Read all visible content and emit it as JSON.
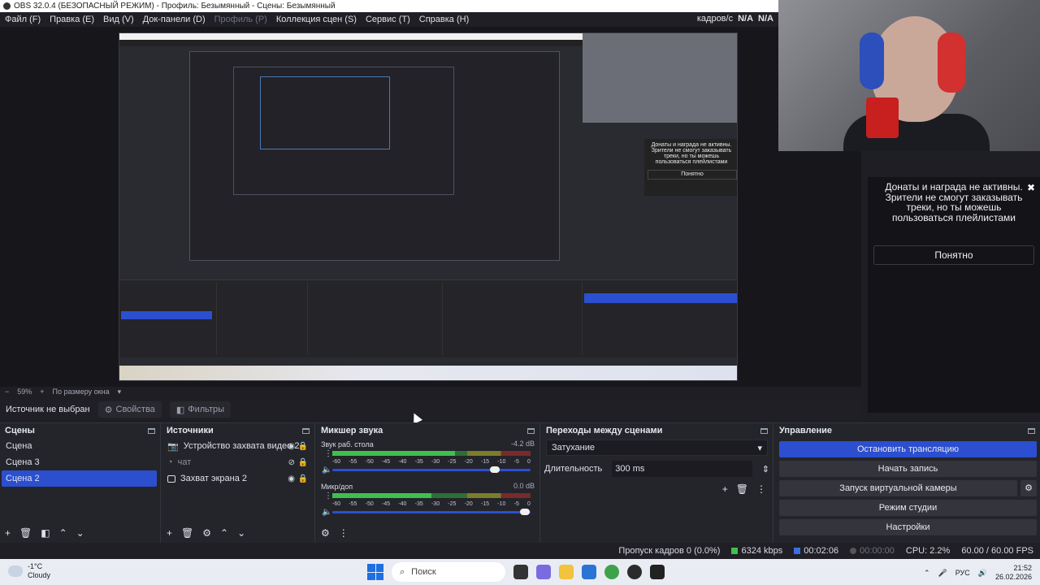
{
  "window": {
    "title": "OBS 32.0.4 (БЕЗОПАСНЫЙ РЕЖИМ) - Профиль: Безымянный - Сцены: Безымянный"
  },
  "menu": {
    "items": [
      {
        "label": "Файл (F)",
        "enabled": true
      },
      {
        "label": "Правка (E)",
        "enabled": true
      },
      {
        "label": "Вид (V)",
        "enabled": true
      },
      {
        "label": "Док-панели (D)",
        "enabled": true
      },
      {
        "label": "Профиль (P)",
        "enabled": false
      },
      {
        "label": "Коллекция сцен (S)",
        "enabled": true
      },
      {
        "label": "Сервис (T)",
        "enabled": true
      },
      {
        "label": "Справка (H)",
        "enabled": true
      }
    ],
    "fps_label": "кадров/с",
    "fps_value1": "N/A",
    "fps_value2": "N/A"
  },
  "preview": {
    "nested_donat_text": "Донаты и награда не активны. Зрители не смогут заказывать треки, но ты можешь пользоваться плейлистами",
    "nested_ok": "Понятно"
  },
  "donat": {
    "message": "Донаты и награда не активны. Зрители не смогут заказывать треки, но ты можешь пользоваться плейлистами",
    "ok_label": "Понятно"
  },
  "zoom": {
    "value": "59%",
    "mode": "По размеру окна"
  },
  "source_bar": {
    "no_source": "Источник не выбран",
    "properties": "Свойства",
    "filters": "Фильтры"
  },
  "scenes": {
    "title": "Сцены",
    "items": [
      {
        "label": "Сцена",
        "selected": false
      },
      {
        "label": "Сцена 3",
        "selected": false
      },
      {
        "label": "Сцена 2",
        "selected": true
      }
    ]
  },
  "sources": {
    "title": "Источники",
    "items": [
      {
        "label": "Устройство захвата видео 2",
        "visible": true
      },
      {
        "label": "чат",
        "visible": false
      },
      {
        "label": "Захват экрана 2",
        "visible": true
      }
    ]
  },
  "mixer": {
    "title": "Микшер звука",
    "channels": [
      {
        "name": "Звук раб. стола",
        "db": "-4.2 dB",
        "level": 0.62,
        "volume": 0.82
      },
      {
        "name": "Микр/доп",
        "db": "0.0 dB",
        "level": 0.5,
        "volume": 0.97
      }
    ],
    "scale": [
      "-60",
      "-55",
      "-50",
      "-45",
      "-40",
      "-35",
      "-30",
      "-25",
      "-20",
      "-15",
      "-10",
      "-5",
      "0"
    ]
  },
  "transitions": {
    "title": "Переходы между сценами",
    "selected": "Затухание",
    "duration_label": "Длительность",
    "duration_value": "300 ms"
  },
  "controls": {
    "title": "Управление",
    "buttons": [
      {
        "label": "Остановить трансляцию",
        "primary": true
      },
      {
        "label": "Начать запись",
        "primary": false
      },
      {
        "label": "Запуск виртуальной камеры",
        "primary": false
      },
      {
        "label": "Режим студии",
        "primary": false
      },
      {
        "label": "Настройки",
        "primary": false
      }
    ]
  },
  "status": {
    "dropped": "Пропуск кадров 0 (0.0%)",
    "bitrate": "6324 kbps",
    "stream_time": "00:02:06",
    "rec_time": "00:00:00",
    "cpu": "CPU: 2.2%",
    "fps": "60.00 / 60.00 FPS"
  },
  "taskbar": {
    "temp": "-1°C",
    "weather": "Cloudy",
    "search": "Поиск",
    "lang": "РУС",
    "time": "21:52",
    "date": "26.02.2026"
  },
  "colors": {
    "accent": "#2c4fcf",
    "background": "#1e1e24",
    "panel": "#24242b"
  }
}
